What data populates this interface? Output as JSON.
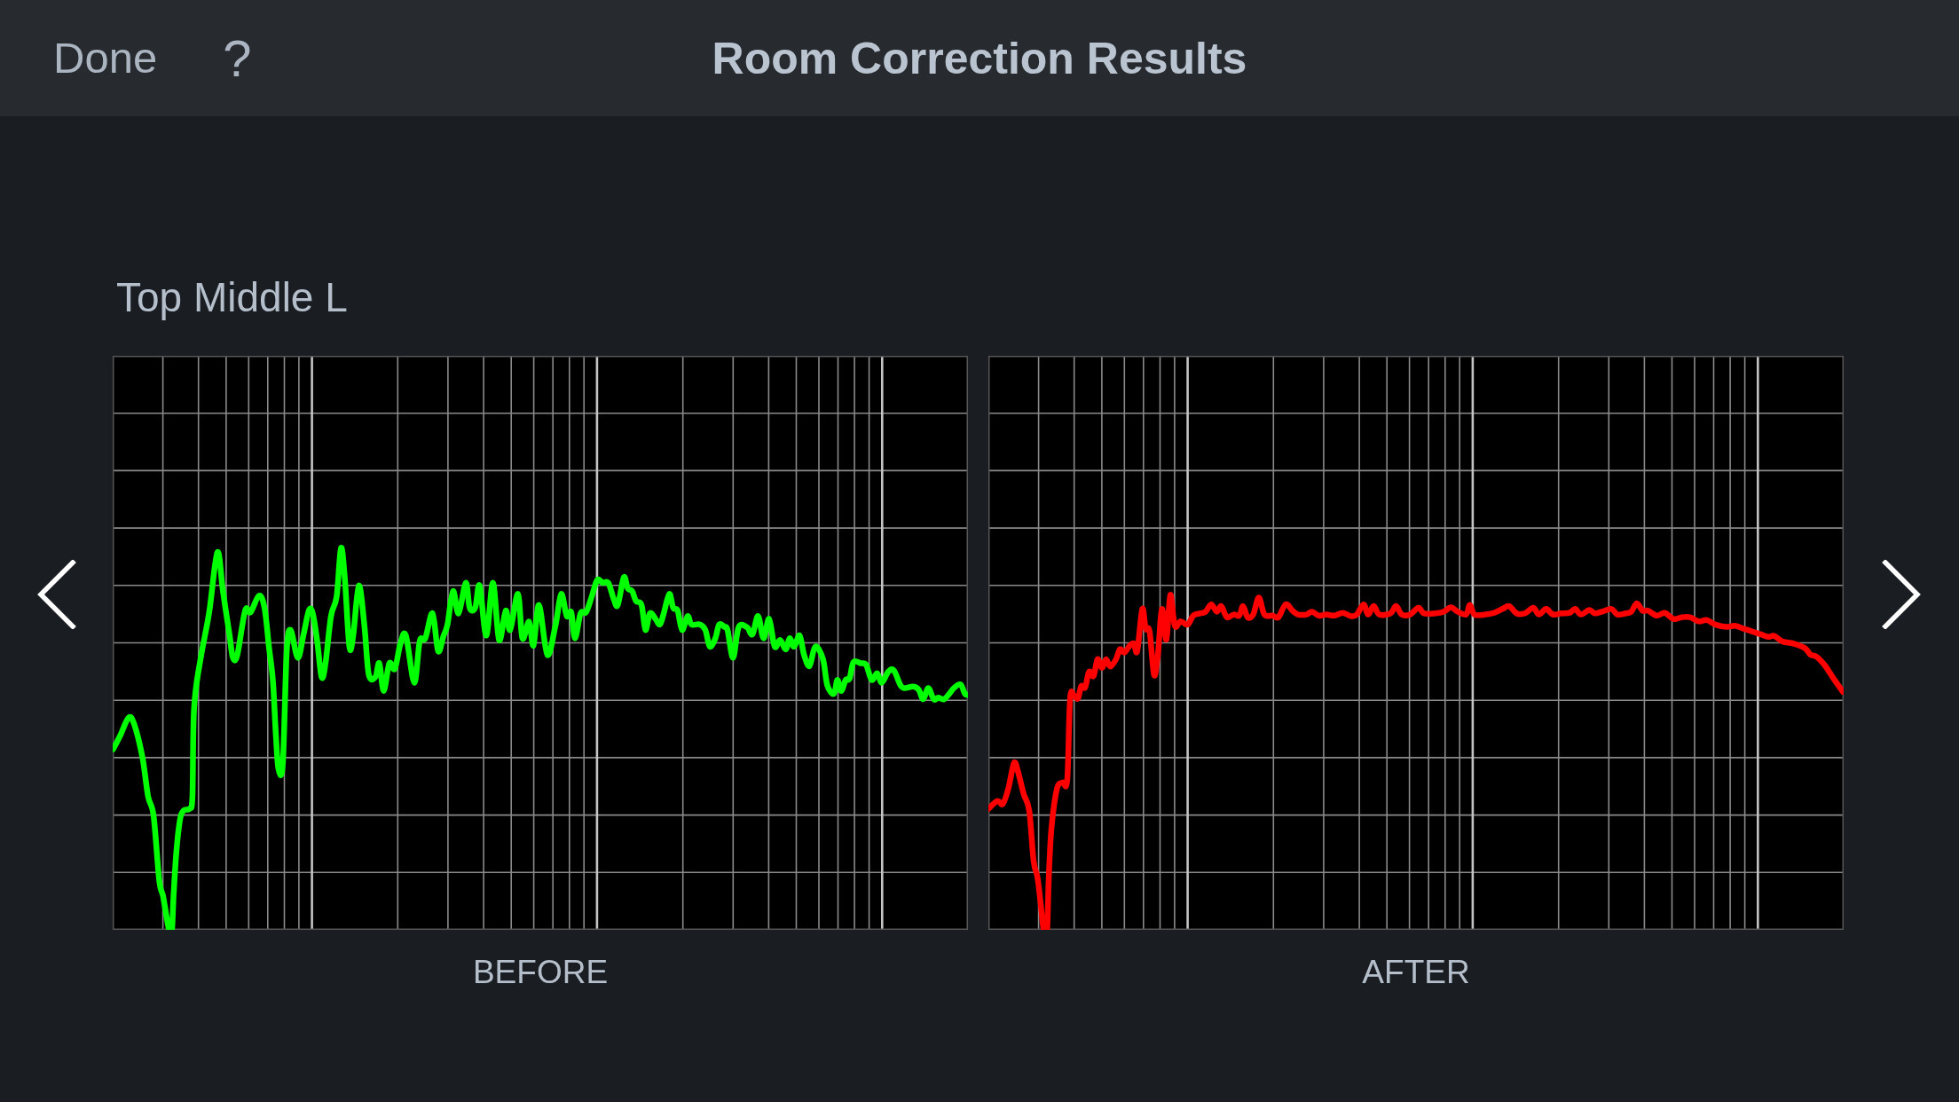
{
  "top_bar": {
    "done_button": "Done",
    "help_button": "?",
    "title": "Room Correction Results"
  },
  "speaker": "Top Middle L",
  "graphs": [
    {
      "label": "BEFORE",
      "color": "#00ff00"
    },
    {
      "label": "AFTER",
      "color": "#ff0000"
    }
  ]
}
